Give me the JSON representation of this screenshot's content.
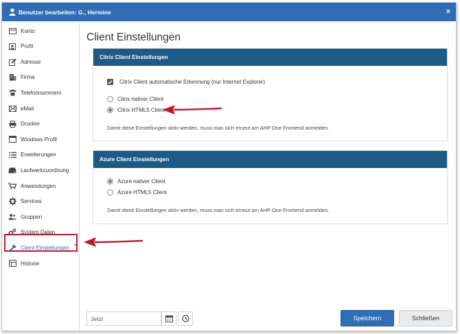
{
  "window": {
    "title": "Benutzer bearbeiten: G., Hermine",
    "close_label": "×"
  },
  "sidebar": {
    "items": [
      {
        "label": "Konto",
        "icon": "card-icon"
      },
      {
        "label": "Profil",
        "icon": "profile-icon"
      },
      {
        "label": "Adresse",
        "icon": "edit-icon"
      },
      {
        "label": "Firma",
        "icon": "building-icon"
      },
      {
        "label": "Telefonnummern",
        "icon": "phone-icon"
      },
      {
        "label": "eMail",
        "icon": "envelope-icon"
      },
      {
        "label": "Drucker",
        "icon": "printer-icon"
      },
      {
        "label": "Windows Profil",
        "icon": "window-icon"
      },
      {
        "label": "Erweiterungen",
        "icon": "list-icon"
      },
      {
        "label": "Laufwerkzuordnung",
        "icon": "drive-icon"
      },
      {
        "label": "Anwendungen",
        "icon": "cart-icon"
      },
      {
        "label": "Services",
        "icon": "gear-icon"
      },
      {
        "label": "Gruppen",
        "icon": "group-icon"
      },
      {
        "label": "System Daten",
        "icon": "cogs-icon"
      },
      {
        "label": "Client Einstellungen",
        "icon": "wrench-icon"
      },
      {
        "label": "Historie",
        "icon": "history-icon"
      }
    ],
    "active_index": 14
  },
  "main": {
    "title": "Client Einstellungen",
    "citrix": {
      "header": "Citrix Client Einstellungen",
      "auto_detect_label": "Citrix Client automatische Erkennung (nur Internet Explorer)",
      "auto_detect_checked": true,
      "options": [
        {
          "label": "Citrix nativer Client",
          "selected": false
        },
        {
          "label": "Citrix HTML5 Client",
          "selected": true
        }
      ],
      "note": "Damit diese Einstellungen aktiv werden, muss man sich erneut am AHP One Frontend anmelden."
    },
    "azure": {
      "header": "Azure Client Einstellungen",
      "options": [
        {
          "label": "Azure nativer Client",
          "selected": true
        },
        {
          "label": "Azure HTML5 Client",
          "selected": false
        }
      ],
      "note": "Damit diese Einstellungen aktiv werden, muss man sich erneut am AHP One Frontend anmelden."
    }
  },
  "footer": {
    "date_placeholder": "Jetzt",
    "save_label": "Speichern",
    "close_label": "Schließen"
  },
  "colors": {
    "titlebar": "#2f6db5",
    "panel_header": "#1d5a86",
    "annotation": "#c0182b"
  }
}
